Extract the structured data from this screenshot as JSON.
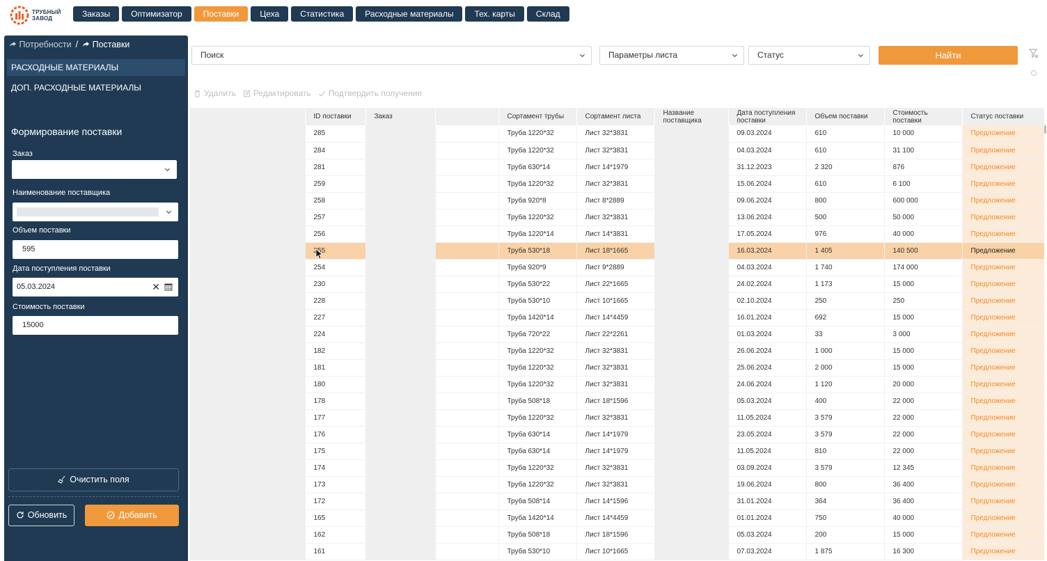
{
  "logo": {
    "line1": "ТРУБНЫЙ",
    "line2": "ЗАВОД"
  },
  "nav": [
    {
      "label": "Заказы",
      "active": false
    },
    {
      "label": "Оптимизатор",
      "active": false
    },
    {
      "label": "Поставки",
      "active": true
    },
    {
      "label": "Цеха",
      "active": false
    },
    {
      "label": "Статистика",
      "active": false
    },
    {
      "label": "Расходные материалы",
      "active": false
    },
    {
      "label": "Тех. карты",
      "active": false
    },
    {
      "label": "Склад",
      "active": false
    }
  ],
  "sidebar": {
    "breadcrumb": {
      "parent": "Потребности",
      "separator": "/",
      "current": "Поставки"
    },
    "items": [
      {
        "label": "Расходные материалы",
        "active": true
      },
      {
        "label": "Доп. расходные материалы",
        "active": false
      }
    ],
    "form": {
      "title": "Формирование поставки",
      "order_label": "Заказ",
      "order_value": "",
      "supplier_label": "Наименование поставщика",
      "volume_label": "Объем поставки",
      "volume_value": "595",
      "date_label": "Дата поступления поставки",
      "date_value": "05.03.2024",
      "cost_label": "Стоимость поставки",
      "cost_value": "15000"
    },
    "clear_label": "Очистить поля",
    "refresh_label": "Обновить",
    "add_label": "Добавить"
  },
  "filters": {
    "search": "Поиск",
    "sheet_params": "Параметры листа",
    "status": "Статус",
    "find_label": "Найти"
  },
  "actions": {
    "delete": "Удалить",
    "edit": "Редактировать",
    "confirm": "Подтвердить получение"
  },
  "columns": [
    "",
    "ID поставки",
    "Заказ",
    "",
    "Сортамент трубы",
    "Сортамент листа",
    "Название поставщика",
    "Дата поступления поставки",
    "Объем поставки",
    "Стоимость поставки",
    "Статус поставки"
  ],
  "rows": [
    {
      "id": "285",
      "pipe": "Труба 1220*32",
      "sheet": "Лист 32*3831",
      "date": "09.03.2024",
      "volume": "610",
      "cost": "10 000",
      "status": "Предложение"
    },
    {
      "id": "284",
      "pipe": "Труба 1220*32",
      "sheet": "Лист 32*3831",
      "date": "04.03.2024",
      "volume": "610",
      "cost": "31 100",
      "status": "Предложение"
    },
    {
      "id": "281",
      "pipe": "Труба 630*14",
      "sheet": "Лист 14*1979",
      "date": "31.12.2023",
      "volume": "2 320",
      "cost": "876",
      "status": "Предложение"
    },
    {
      "id": "259",
      "pipe": "Труба 1220*32",
      "sheet": "Лист 32*3831",
      "date": "15.06.2024",
      "volume": "610",
      "cost": "6 100",
      "status": "Предложение"
    },
    {
      "id": "258",
      "pipe": "Труба 920*8",
      "sheet": "Лист 8*2889",
      "date": "09.06.2024",
      "volume": "800",
      "cost": "600 000",
      "status": "Предложение"
    },
    {
      "id": "257",
      "pipe": "Труба 1220*32",
      "sheet": "Лист 32*3831",
      "date": "13.06.2024",
      "volume": "500",
      "cost": "50 000",
      "status": "Предложение"
    },
    {
      "id": "256",
      "pipe": "Труба 1220*14",
      "sheet": "Лист 14*3831",
      "date": "17.05.2024",
      "volume": "976",
      "cost": "40 000",
      "status": "Предложение"
    },
    {
      "id": "255",
      "pipe": "Труба 530*18",
      "sheet": "Лист 18*1665",
      "date": "16.03.2024",
      "volume": "1 405",
      "cost": "140 500",
      "status": "Предложение",
      "selected": true
    },
    {
      "id": "254",
      "pipe": "Труба 920*9",
      "sheet": "Лист 9*2889",
      "date": "04.03.2024",
      "volume": "1 740",
      "cost": "174 000",
      "status": "Предложение"
    },
    {
      "id": "230",
      "pipe": "Труба 530*22",
      "sheet": "Лист 22*1665",
      "date": "24.02.2024",
      "volume": "1 173",
      "cost": "15 000",
      "status": "Предложение"
    },
    {
      "id": "228",
      "pipe": "Труба 530*10",
      "sheet": "Лист 10*1665",
      "date": "02.10.2024",
      "volume": "250",
      "cost": "250",
      "status": "Предложение"
    },
    {
      "id": "227",
      "pipe": "Труба 1420*14",
      "sheet": "Лист 14*4459",
      "date": "16.01.2024",
      "volume": "692",
      "cost": "15 000",
      "status": "Предложение"
    },
    {
      "id": "224",
      "pipe": "Труба 720*22",
      "sheet": "Лист 22*2261",
      "date": "01.03.2024",
      "volume": "33",
      "cost": "3 000",
      "status": "Предложение"
    },
    {
      "id": "182",
      "pipe": "Труба 1220*32",
      "sheet": "Лист 32*3831",
      "date": "26.06.2024",
      "volume": "1 000",
      "cost": "15 000",
      "status": "Предложение"
    },
    {
      "id": "181",
      "pipe": "Труба 1220*32",
      "sheet": "Лист 32*3831",
      "date": "25.06.2024",
      "volume": "2 000",
      "cost": "15 000",
      "status": "Предложение"
    },
    {
      "id": "180",
      "pipe": "Труба 1220*32",
      "sheet": "Лист 32*3831",
      "date": "24.06.2024",
      "volume": "1 120",
      "cost": "20 000",
      "status": "Предложение"
    },
    {
      "id": "178",
      "pipe": "Труба 508*18",
      "sheet": "Лист 18*1596",
      "date": "05.03.2024",
      "volume": "400",
      "cost": "22 000",
      "status": "Предложение"
    },
    {
      "id": "177",
      "pipe": "Труба 1220*32",
      "sheet": "Лист 32*3831",
      "date": "11.05.2024",
      "volume": "3 579",
      "cost": "22 000",
      "status": "Предложение"
    },
    {
      "id": "176",
      "pipe": "Труба 630*14",
      "sheet": "Лист 14*1979",
      "date": "23.05.2024",
      "volume": "3 579",
      "cost": "22 000",
      "status": "Предложение"
    },
    {
      "id": "175",
      "pipe": "Труба 630*14",
      "sheet": "Лист 14*1979",
      "date": "11.05.2024",
      "volume": "810",
      "cost": "22 000",
      "status": "Предложение"
    },
    {
      "id": "174",
      "pipe": "Труба 1220*32",
      "sheet": "Лист 32*3831",
      "date": "03.09.2024",
      "volume": "3 579",
      "cost": "12 345",
      "status": "Предложение"
    },
    {
      "id": "173",
      "pipe": "Труба 1220*32",
      "sheet": "Лист 32*3831",
      "date": "19.06.2024",
      "volume": "800",
      "cost": "36 400",
      "status": "Предложение"
    },
    {
      "id": "172",
      "pipe": "Труба 508*14",
      "sheet": "Лист 14*1596",
      "date": "31.01.2024",
      "volume": "364",
      "cost": "36 400",
      "status": "Предложение"
    },
    {
      "id": "165",
      "pipe": "Труба 1420*14",
      "sheet": "Лист 14*4459",
      "date": "01.01.2024",
      "volume": "750",
      "cost": "40 000",
      "status": "Предложение"
    },
    {
      "id": "162",
      "pipe": "Труба 508*18",
      "sheet": "Лист 18*1596",
      "date": "05.03.2024",
      "volume": "200",
      "cost": "15 000",
      "status": "Предложение"
    },
    {
      "id": "161",
      "pipe": "Труба 530*10",
      "sheet": "Лист 10*1665",
      "date": "07.03.2024",
      "volume": "1 875",
      "cost": "16 300",
      "status": "Предложение"
    }
  ],
  "colors": {
    "navy": "#1f3a52",
    "accent": "#f0993c",
    "status_text": "#ef8b2c"
  }
}
